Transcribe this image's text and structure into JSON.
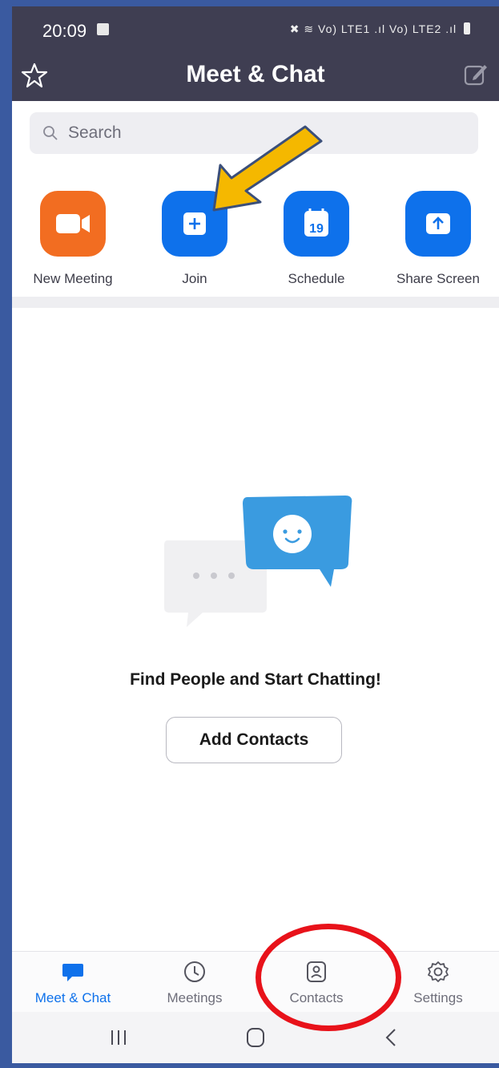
{
  "status_bar": {
    "time": "20:09",
    "network": "Vo) LTE1 .ıl Vo) LTE2 .ıl"
  },
  "app_bar": {
    "title": "Meet & Chat",
    "left_icon": "star-icon",
    "right_icon": "compose-icon"
  },
  "search": {
    "placeholder": "Search"
  },
  "actions": [
    {
      "label": "New Meeting",
      "icon": "video-camera-icon",
      "color": "#f26d21"
    },
    {
      "label": "Join",
      "icon": "plus-icon",
      "color": "#0e71eb"
    },
    {
      "label": "Schedule",
      "icon": "calendar-icon",
      "color": "#0e71eb",
      "calendar_day": "19"
    },
    {
      "label": "Share Screen",
      "icon": "share-screen-icon",
      "color": "#0e71eb"
    }
  ],
  "empty_state": {
    "title": "Find People and Start Chatting!",
    "button": "Add Contacts"
  },
  "tabs": [
    {
      "label": "Meet & Chat",
      "icon": "chat-bubble-icon",
      "active": true
    },
    {
      "label": "Meetings",
      "icon": "clock-icon",
      "active": false
    },
    {
      "label": "Contacts",
      "icon": "contact-card-icon",
      "active": false
    },
    {
      "label": "Settings",
      "icon": "gear-icon",
      "active": false
    }
  ],
  "annotations": {
    "arrow_color": "#f5b800",
    "circle_color": "#e8121a"
  },
  "colors": {
    "accent": "#0e71eb",
    "orange": "#f26d21",
    "header": "#3f3e52"
  }
}
